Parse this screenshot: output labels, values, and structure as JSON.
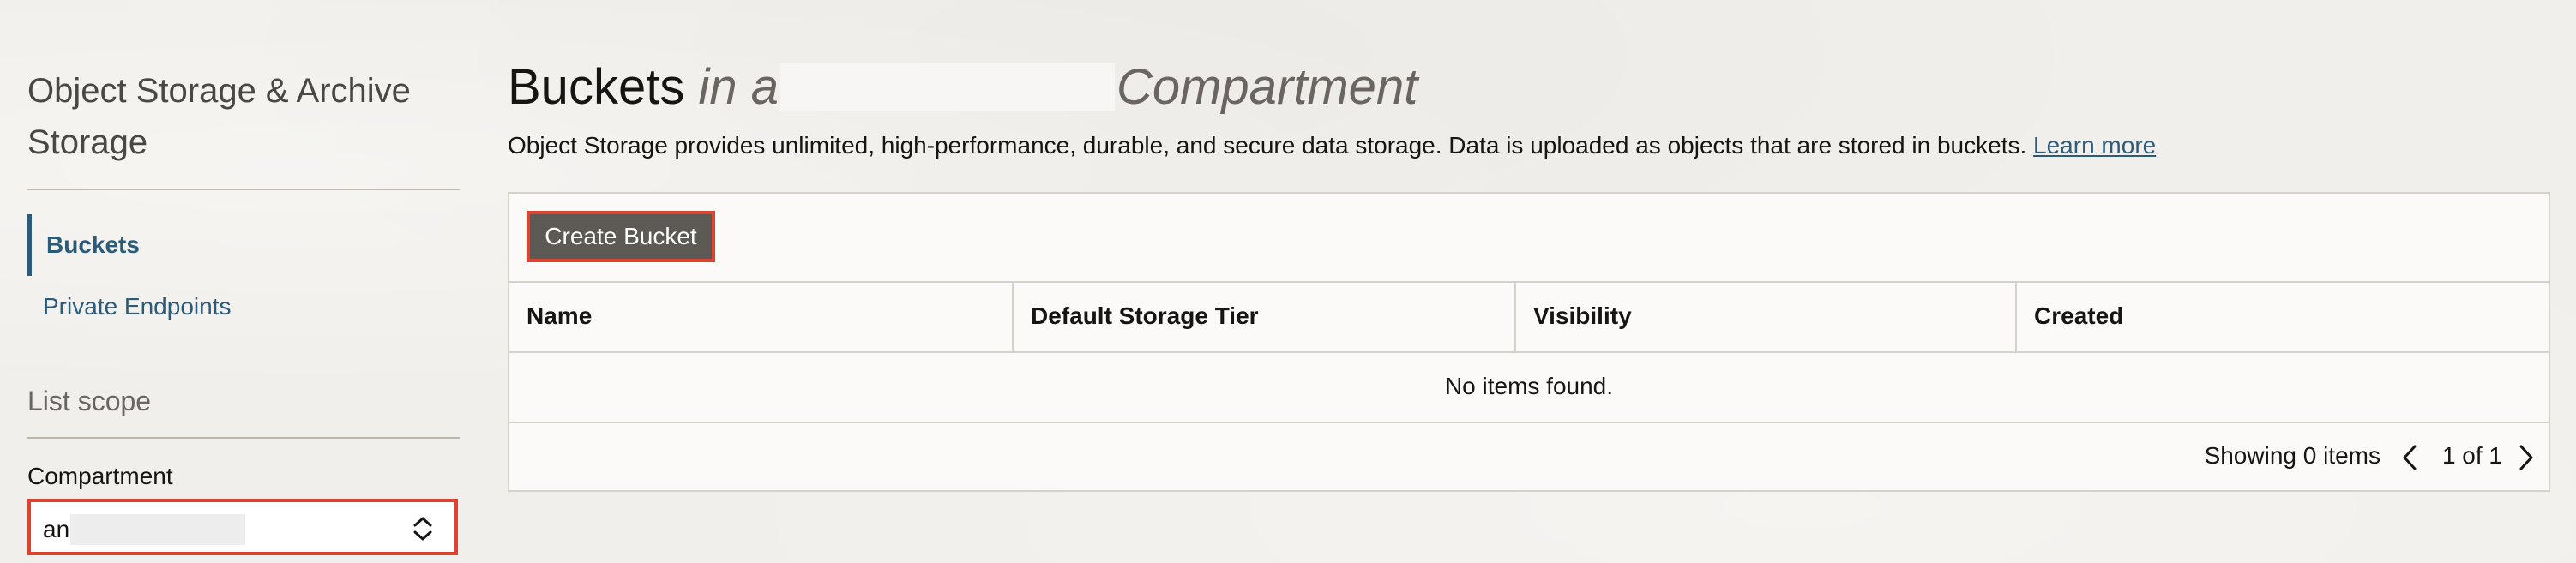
{
  "sidebar": {
    "title": "Object Storage & Archive Storage",
    "nav": [
      {
        "label": "Buckets",
        "active": true
      },
      {
        "label": "Private Endpoints",
        "active": false
      }
    ],
    "list_scope_label": "List scope",
    "compartment_label": "Compartment",
    "compartment_value": "an"
  },
  "main": {
    "title_prefix": "Buckets",
    "title_in": "in a",
    "title_suffix": "Compartment",
    "description": "Object Storage provides unlimited, high-performance, durable, and secure data storage. Data is uploaded as objects that are stored in buckets.",
    "learn_more": "Learn more",
    "create_button": "Create Bucket",
    "columns": [
      "Name",
      "Default Storage Tier",
      "Visibility",
      "Created"
    ],
    "empty_message": "No items found.",
    "showing": "Showing 0 items",
    "page_info": "1 of 1"
  },
  "colors": {
    "accent": "#2c5b7a",
    "highlight": "#e0422e",
    "button_bg": "#5d5955"
  },
  "icons": {
    "select": "chevron-up-down-icon",
    "prev": "chevron-left-icon",
    "next": "chevron-right-icon"
  }
}
